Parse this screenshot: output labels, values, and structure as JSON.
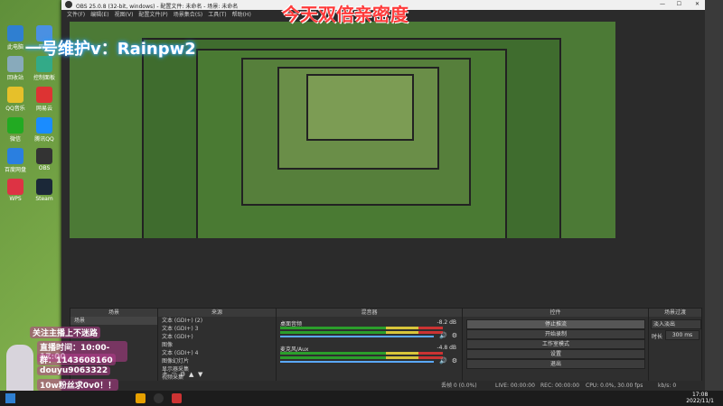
{
  "overlay": {
    "banner_text": "今天双倍亲密度",
    "watermark_left": "一号维护v：Rainpw2",
    "schedule_title": "关注主播上不迷路",
    "hours": "直播时间：10:00-17:00",
    "qq": "群：1143608160",
    "douyu": "douyu9063322",
    "fan_note": "10w粉丝求0v0！！"
  },
  "desktop": {
    "icons": [
      {
        "label": "此电脑",
        "color": "#2f7fd1"
      },
      {
        "label": "网络",
        "color": "#4a90e2"
      },
      {
        "label": "回收站",
        "color": "#8ab"
      },
      {
        "label": "控制面板",
        "color": "#3a8"
      },
      {
        "label": "QQ音乐",
        "color": "#e6c02a"
      },
      {
        "label": "网易云",
        "color": "#d33"
      },
      {
        "label": "微信",
        "color": "#2a2"
      },
      {
        "label": "腾讯QQ",
        "color": "#1a8cff"
      },
      {
        "label": "百度网盘",
        "color": "#2a7fe0"
      },
      {
        "label": "OBS",
        "color": "#333"
      },
      {
        "label": "WPS",
        "color": "#d34"
      },
      {
        "label": "Steam",
        "color": "#1b2838"
      }
    ]
  },
  "obs": {
    "title": "OBS 25.0.8 (32-bit, windows) - 配置文件: 未命名 - 场景: 未命名",
    "menu": [
      "文件(F)",
      "编辑(E)",
      "视图(V)",
      "配置文件(P)",
      "场景集合(S)",
      "工具(T)",
      "帮助(H)"
    ],
    "scenes": {
      "header": "场景",
      "items": [
        "场景"
      ]
    },
    "sources": {
      "header": "来源",
      "items": [
        "文本 (GDI+) (2)",
        "文本 (GDI+) 3",
        "文本 (GDI+)",
        "图像",
        "文本 (GDI+) 4",
        "图像幻灯片",
        "显示器采集",
        "视频采集"
      ]
    },
    "mixer": {
      "header": "混音器",
      "channels": [
        {
          "name": "桌面音频",
          "db": "-8.2 dB"
        },
        {
          "name": "麦克风/Aux",
          "db": "-4.8 dB"
        }
      ]
    },
    "transitions": {
      "header": "场景过渡",
      "type": "淡入淡出",
      "duration_label": "时长",
      "duration_value": "300 ms"
    },
    "controls": {
      "header": "控件",
      "buttons": [
        "停止推流",
        "开始录制",
        "工作室模式",
        "设置",
        "退出"
      ]
    },
    "status": {
      "dropped": "丢帧 0 (0.0%)",
      "live": "LIVE: 00:00:00",
      "rec": "REC: 00:00:00",
      "cpu": "CPU: 0.0%, 30.00 fps",
      "kbps": "kb/s: 0"
    }
  },
  "taskbar": {
    "time": "17:08",
    "date": "2022/11/1"
  },
  "colors": {
    "accent": "#ff3a3a",
    "obs_bg": "#2b2b2b",
    "selected": "#565656"
  }
}
